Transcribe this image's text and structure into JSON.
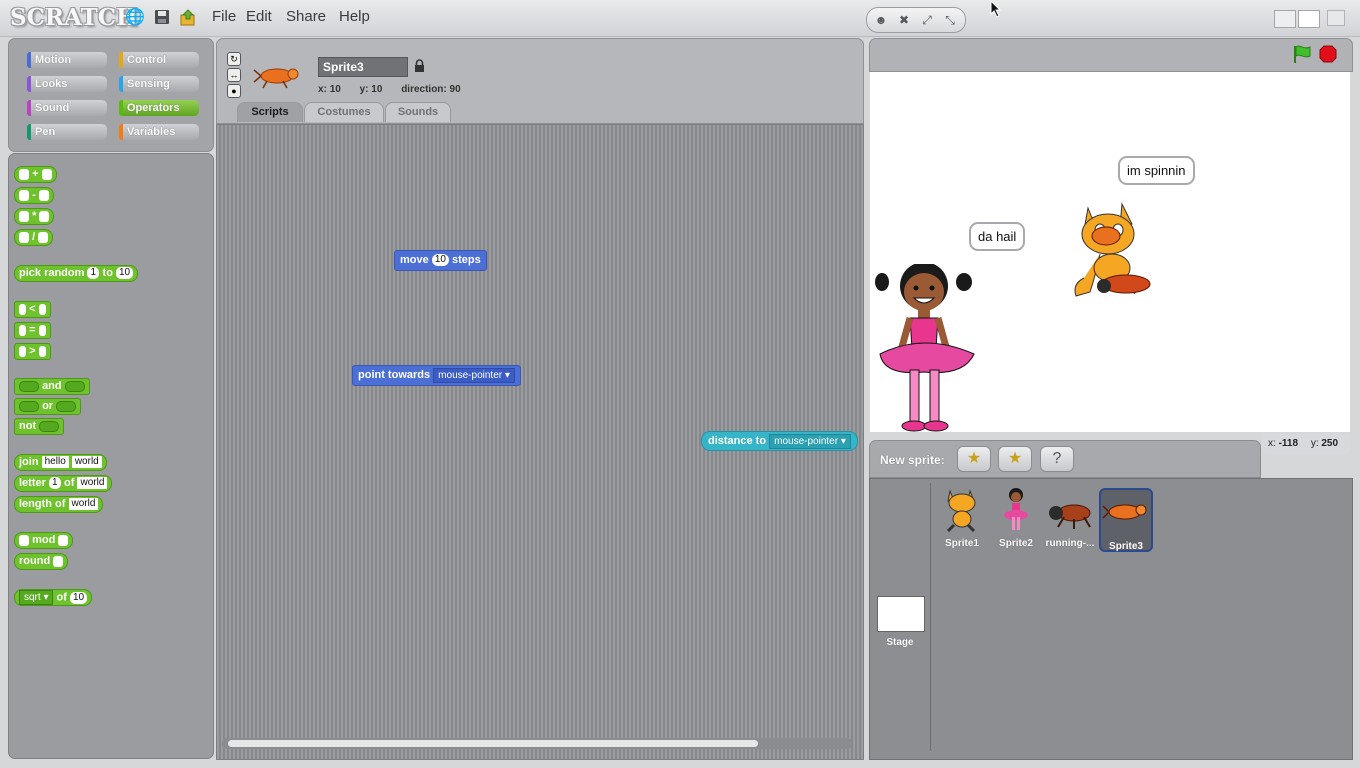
{
  "app": {
    "logo": "SCRATCH"
  },
  "menu": {
    "file": "File",
    "edit": "Edit",
    "share": "Share",
    "help": "Help"
  },
  "categories": [
    {
      "label": "Motion",
      "color": "#4a6cd4"
    },
    {
      "label": "Control",
      "color": "#e1a91a"
    },
    {
      "label": "Looks",
      "color": "#8a55d7"
    },
    {
      "label": "Sensing",
      "color": "#2ca5e2"
    },
    {
      "label": "Sound",
      "color": "#bb42c3"
    },
    {
      "label": "Operators",
      "color": "#5cb712"
    },
    {
      "label": "Pen",
      "color": "#0e9a6c"
    },
    {
      "label": "Variables",
      "color": "#ee7d16"
    }
  ],
  "operators": {
    "plus": "+",
    "minus": "-",
    "times": "*",
    "divide": "/",
    "pick_random": "pick random",
    "random_from": "1",
    "random_to_label": "to",
    "random_to": "10",
    "lt": "<",
    "eq": "=",
    "gt": ">",
    "and": "and",
    "or": "or",
    "not": "not",
    "join": "join",
    "join_a": "hello",
    "join_b": "world",
    "letter": "letter",
    "letter_n": "1",
    "letter_of": "of",
    "letter_word": "world",
    "length_of": "length of",
    "length_word": "world",
    "mod": "mod",
    "round": "round",
    "sqrt": "sqrt",
    "sqrt_of": "of",
    "sqrt_val": "10"
  },
  "sprite": {
    "name": "Sprite3",
    "x_label": "x:",
    "x": "10",
    "y_label": "y:",
    "y": "10",
    "direction_label": "direction:",
    "direction": "90"
  },
  "tabs": {
    "scripts": "Scripts",
    "costumes": "Costumes",
    "sounds": "Sounds"
  },
  "scripts": {
    "move_label": "move",
    "move_value": "10",
    "move_steps": "steps",
    "point_label": "point towards",
    "point_value": "mouse-pointer",
    "distance_label": "distance to",
    "distance_value": "mouse-pointer"
  },
  "stage": {
    "bubble1": "da hail",
    "bubble2": "im spinnin"
  },
  "coords": {
    "x_label": "x:",
    "x": "-118",
    "y_label": "y:",
    "y": "250"
  },
  "new_sprite": {
    "label": "New sprite:"
  },
  "sprites": [
    {
      "name": "Sprite1"
    },
    {
      "name": "Sprite2"
    },
    {
      "name": "running-..."
    },
    {
      "name": "Sprite3"
    }
  ],
  "stage_thumb": {
    "label": "Stage"
  }
}
